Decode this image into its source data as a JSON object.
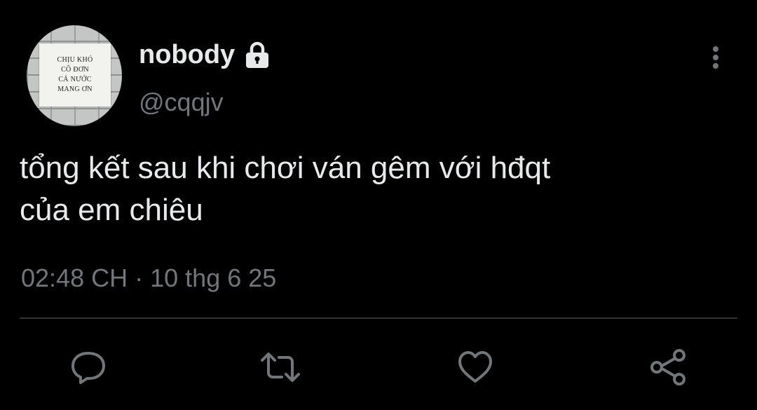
{
  "avatar": {
    "sign_lines": [
      "CHỊU KHÓ",
      "CÔ ĐƠN",
      "CẢ NƯỚC",
      "MANG ƠN"
    ]
  },
  "user": {
    "display_name": "nobody",
    "handle": "@cqqjv",
    "protected_icon": "lock-icon"
  },
  "menu": {
    "icon": "more-vertical-icon"
  },
  "tweet": {
    "text_lines": [
      "tổng kết sau khi chơi ván gêm với hđqt",
      "của em chiêu"
    ],
    "time": "02:48 CH",
    "separator": "·",
    "date": "10 thg 6 25"
  },
  "actions": [
    {
      "icon": "reply-icon"
    },
    {
      "icon": "retweet-icon"
    },
    {
      "icon": "like-icon"
    },
    {
      "icon": "share-icon"
    }
  ],
  "colors": {
    "background": "#000000",
    "primary_text": "#e7e9ea",
    "secondary_text": "#71767b",
    "divider": "#2f3336"
  }
}
